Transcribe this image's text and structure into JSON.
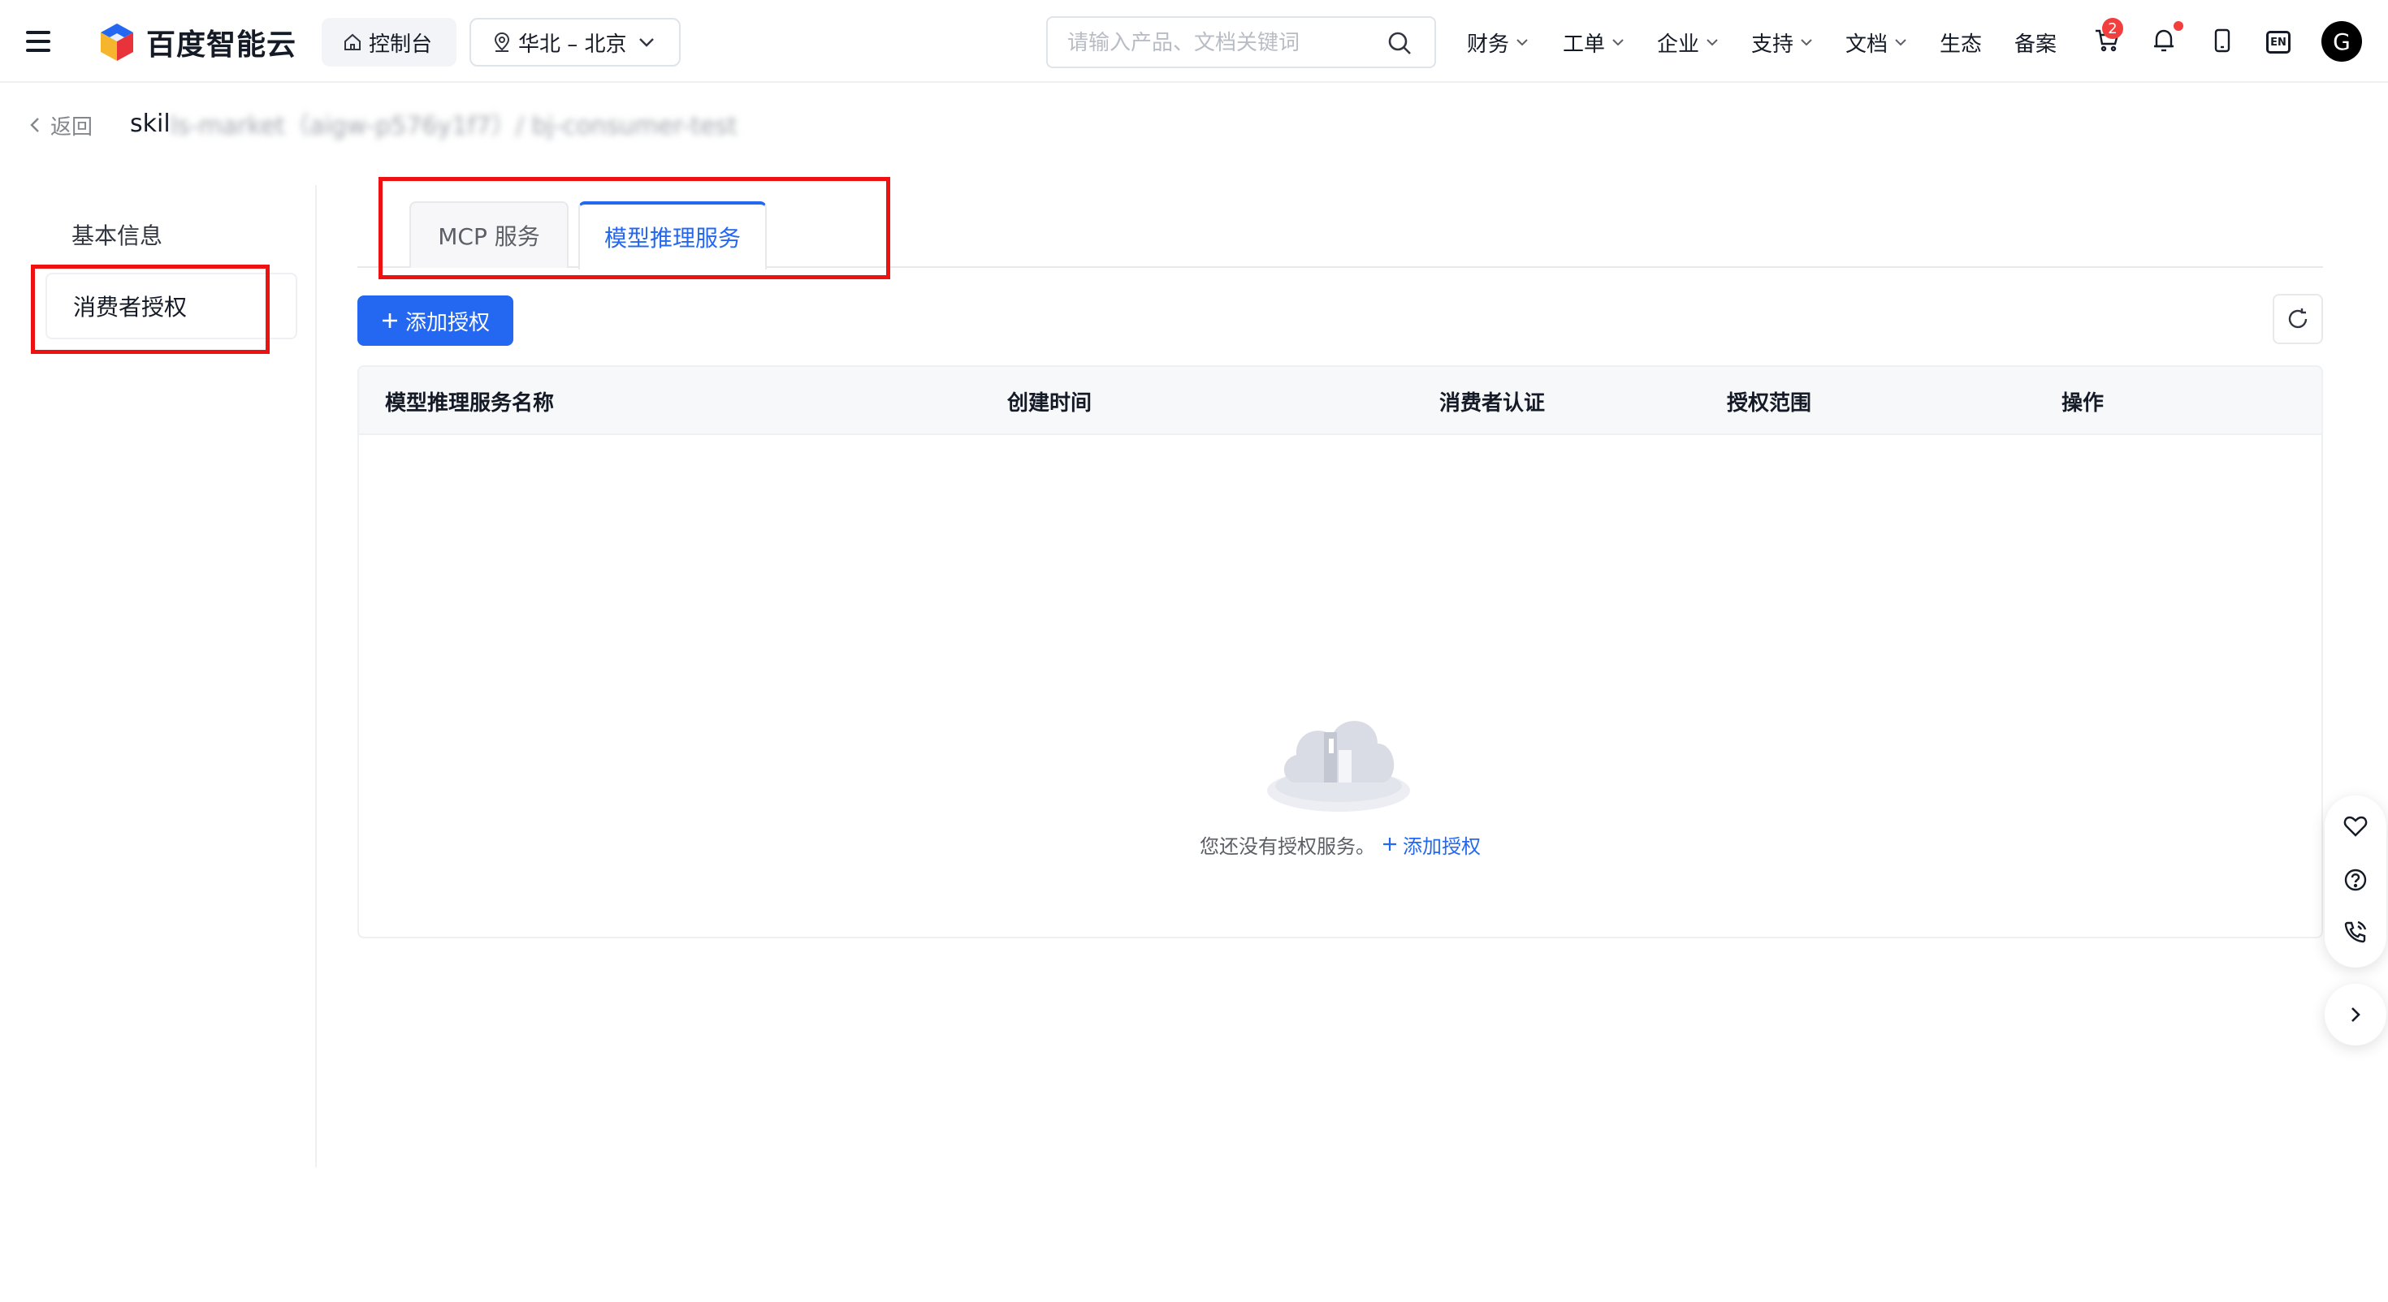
{
  "header": {
    "brand": "百度智能云",
    "console_label": "控制台",
    "region_label": "华北 – 北京",
    "search_placeholder": "请输入产品、文档关键词",
    "nav": [
      "财务",
      "工单",
      "企业",
      "支持",
      "文档",
      "生态",
      "备案"
    ],
    "cart_badge": "2",
    "lang_label": "EN",
    "avatar_initial": "G"
  },
  "breadcrumb": {
    "back_label": "返回",
    "title_visible": "skil",
    "title_blurred": "ls-market（aigw-p576y1f7）/ bj-consumer-test"
  },
  "sidenav": {
    "items": [
      {
        "label": "基本信息",
        "active": false
      },
      {
        "label": "消费者授权",
        "active": true
      }
    ]
  },
  "tabs": [
    {
      "label": "MCP 服务",
      "active": false
    },
    {
      "label": "模型推理服务",
      "active": true
    }
  ],
  "toolbar": {
    "add_label": "添加授权"
  },
  "table": {
    "columns": [
      "模型推理服务名称",
      "创建时间",
      "消费者认证",
      "授权范围",
      "操作"
    ],
    "rows": [],
    "empty_text": "您还没有授权服务。",
    "empty_link": "添加授权"
  },
  "colors": {
    "primary": "#2468f2",
    "annotation": "#ee1111",
    "badge": "#f33e3e"
  },
  "icons": {
    "menu": "hamburger-icon",
    "home": "home-icon",
    "location": "location-pin-icon",
    "search": "search-icon",
    "cart": "cart-icon",
    "bell": "bell-icon",
    "phone": "phone-icon",
    "refresh": "refresh-icon",
    "favorite": "heart-icon",
    "help": "help-icon",
    "call": "phone-call-icon"
  }
}
